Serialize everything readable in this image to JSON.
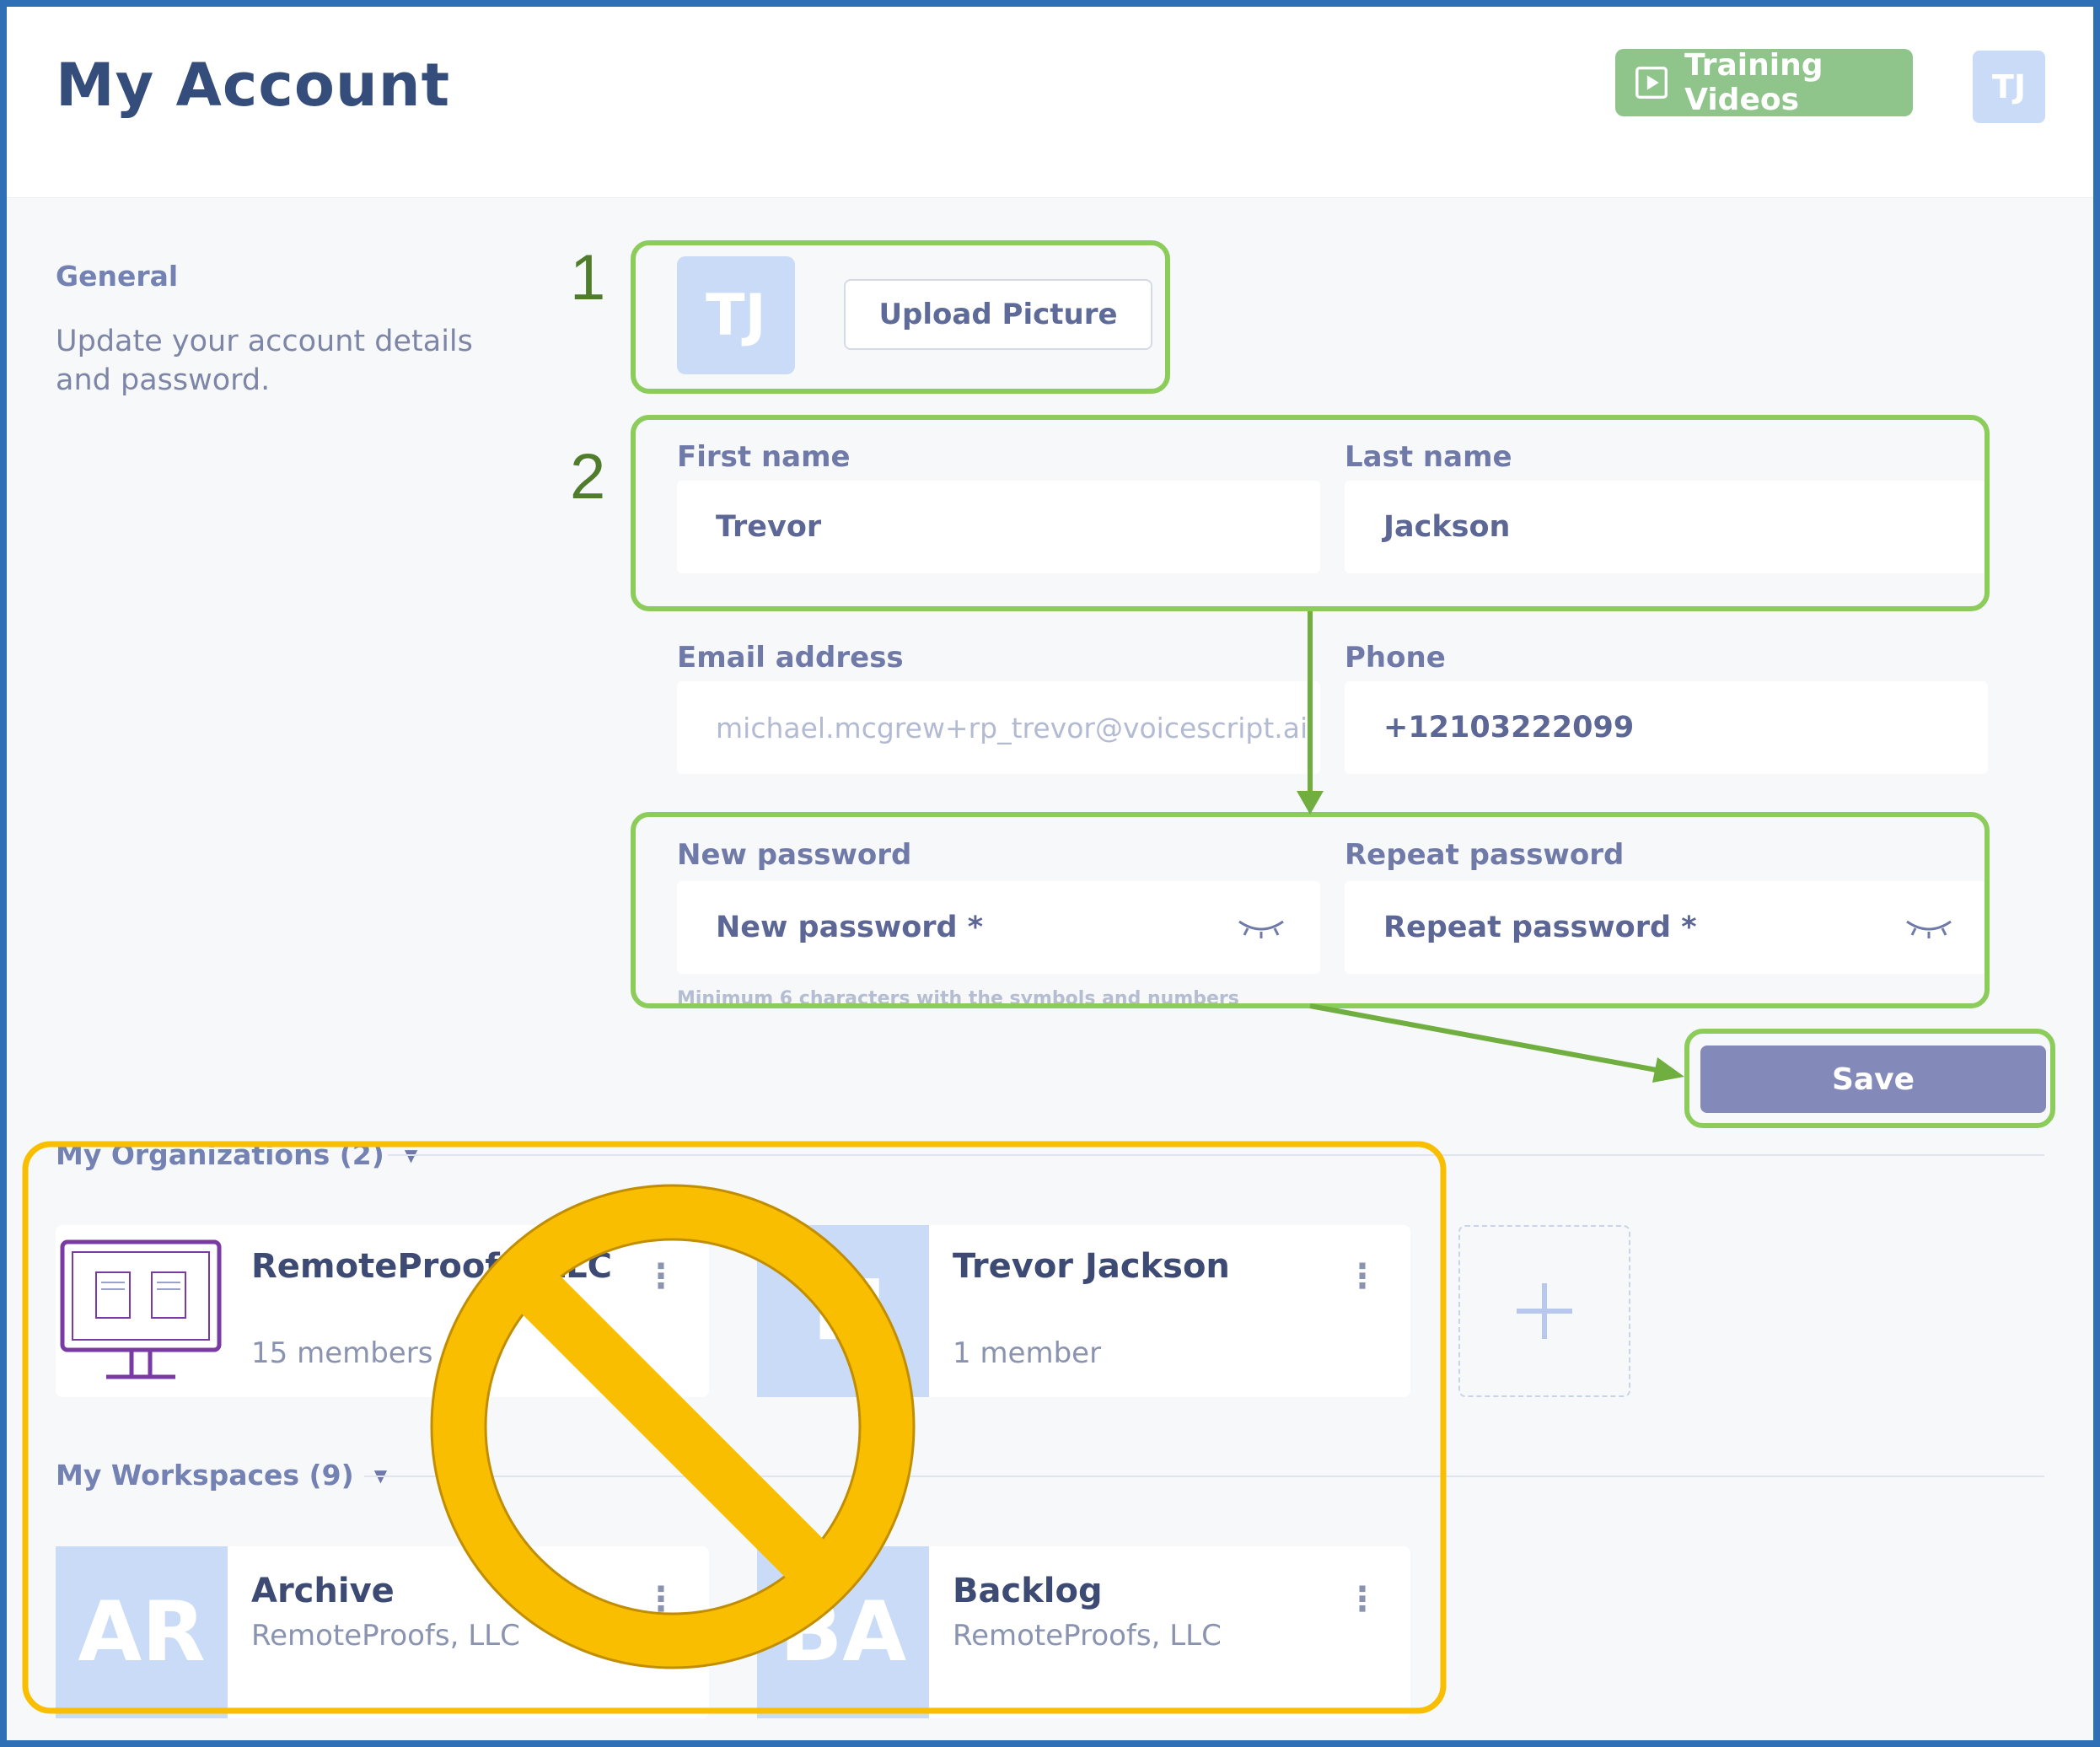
{
  "header": {
    "title": "My Account",
    "training_label": "Training Videos",
    "avatar_initials": "TJ"
  },
  "general": {
    "title": "General",
    "description": "Update your account details and password."
  },
  "profile": {
    "avatar_initials": "TJ",
    "upload_label": "Upload Picture"
  },
  "annotations": {
    "step1": "1",
    "step2": "2"
  },
  "form": {
    "first_name_label": "First name",
    "first_name_value": "Trevor",
    "last_name_label": "Last name",
    "last_name_value": "Jackson",
    "email_label": "Email address",
    "email_value": "michael.mcgrew+rp_trevor@voicescript.ai",
    "phone_label": "Phone",
    "phone_value": "+12103222099",
    "new_password_label": "New password",
    "new_password_placeholder": "New password *",
    "repeat_password_label": "Repeat password",
    "repeat_password_placeholder": "Repeat password *",
    "password_hint": "Minimum 6 characters with the symbols and numbers",
    "save_label": "Save"
  },
  "organizations": {
    "title": "My Organizations (2)",
    "items": [
      {
        "name": "RemoteProofs, LLC",
        "sub": "15 members",
        "icon": "monitor-logo-icon"
      },
      {
        "name": "Trevor Jackson",
        "sub": "1 member",
        "initials": "TJ"
      }
    ],
    "add_label": "+"
  },
  "workspaces": {
    "title": "My Workspaces (9)",
    "items": [
      {
        "name": "Archive",
        "sub": "RemoteProofs, LLC",
        "initials": "AR"
      },
      {
        "name": "Backlog",
        "sub": "RemoteProofs, LLC",
        "initials": "BA"
      }
    ]
  },
  "colors": {
    "frame_border": "#2f6fb5",
    "annotation_green": "#8ccc5a",
    "annotation_orange": "#f9be00",
    "save_button": "#838ab9",
    "training_button": "#8fc48a"
  }
}
